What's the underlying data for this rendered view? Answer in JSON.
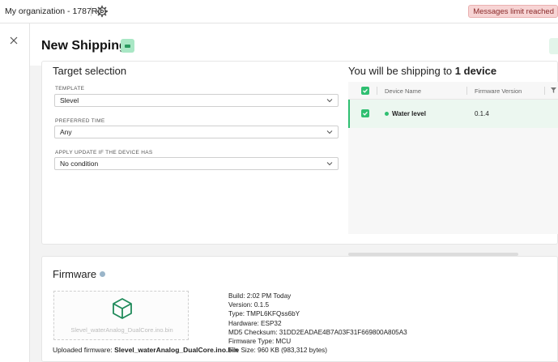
{
  "topbar": {
    "org_name": "My organization - 1787RJ",
    "limit_badge": "Messages limit reached",
    "icons": {
      "org_dropdown": "chevron-down-icon",
      "settings": "gear-icon"
    }
  },
  "sidebar": {
    "close_icon": "close-icon"
  },
  "header": {
    "title": "New Shipping",
    "tag_icon": "tag-icon"
  },
  "target": {
    "title": "Target selection",
    "fields": [
      {
        "label": "TEMPLATE",
        "value": "Slevel"
      },
      {
        "label": "PREFERRED TIME",
        "value": "Any"
      },
      {
        "label": "APPLY UPDATE IF THE DEVICE HAS",
        "value": "No condition"
      }
    ]
  },
  "shipping": {
    "title_prefix": "You will be shipping to",
    "title_count": "1 device",
    "columns": [
      "Device Name",
      "Firmware Version"
    ],
    "rows": [
      {
        "name": "Water level",
        "firmware": "0.1.4",
        "status_color": "#2fbf71",
        "selected": true
      }
    ]
  },
  "firmware": {
    "title": "Firmware",
    "upload_filename": "Slevel_waterAnalog_DualCore.ino.bin",
    "uploaded_label": "Uploaded firmware:",
    "uploaded_file": "Slevel_waterAnalog_DualCore.ino.bin",
    "details": [
      "Build: 2:02 PM Today",
      "Version: 0.1.5",
      "Type: TMPL6KFQss6bY",
      "Hardware: ESP32",
      "MD5 Checksum: 31DD2EADAE4B7A03F31F669800A805A3",
      "Firmware Type: MCU",
      "File Size: 960 KB (983,312 bytes)"
    ]
  },
  "colors": {
    "accent": "#2fbf71",
    "badge_bg": "#f7d4d4"
  }
}
